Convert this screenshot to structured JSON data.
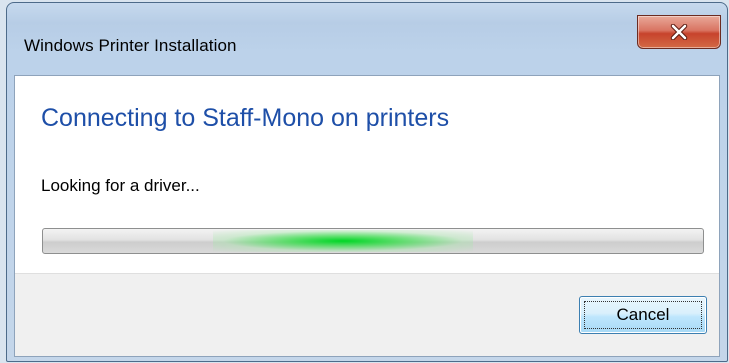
{
  "window": {
    "title": "Windows Printer Installation",
    "close_icon": "close-x-icon"
  },
  "content": {
    "heading": "Connecting to Staff-Mono on printers",
    "status": "Looking for a driver...",
    "progress_state": "indeterminate"
  },
  "footer": {
    "cancel_label": "Cancel"
  },
  "colors": {
    "heading": "#1e4fa8",
    "progress_glow": "#00d625",
    "close_button": "#c7432c"
  }
}
